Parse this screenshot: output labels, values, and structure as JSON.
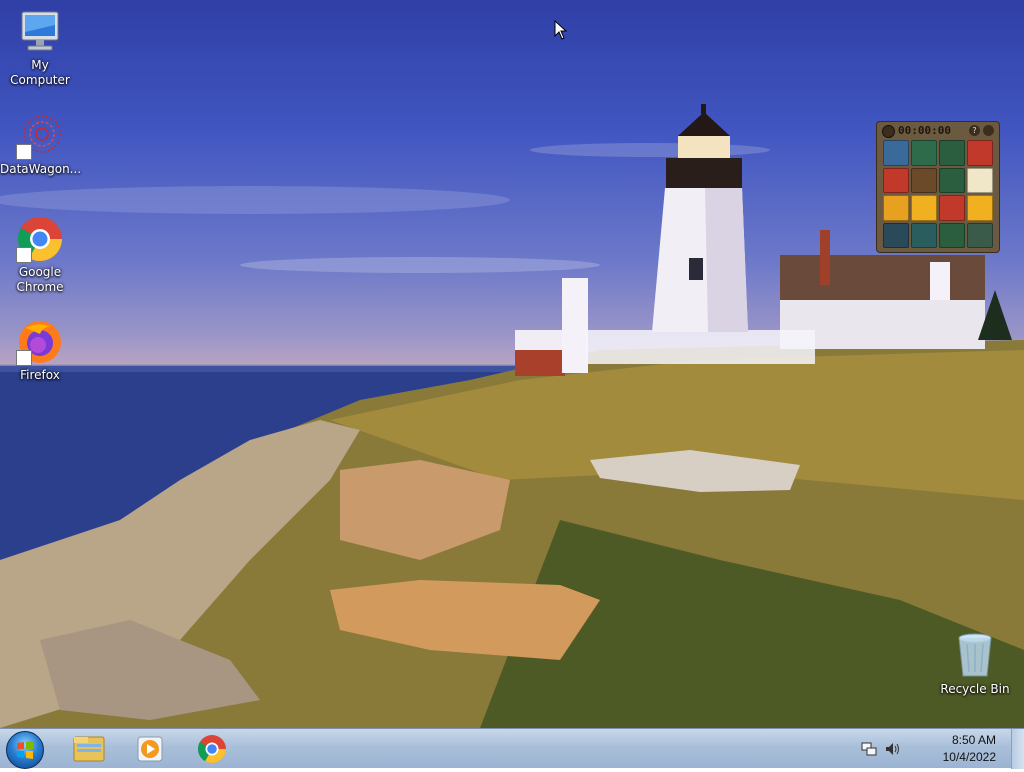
{
  "desktop": {
    "icons": [
      {
        "label": "My Computer",
        "icon": "my-computer-icon"
      },
      {
        "label": "DataWagon...",
        "icon": "datawagon-icon"
      },
      {
        "label": "Google Chrome",
        "label_line1": "Google",
        "label_line2": "Chrome",
        "icon": "chrome-icon"
      },
      {
        "label": "Firefox",
        "icon": "firefox-icon"
      },
      {
        "label": "Recycle Bin",
        "icon": "recycle-bin-icon"
      }
    ]
  },
  "gadget": {
    "name": "puzzle-gadget",
    "timer": "00:00:00",
    "tile_colors": [
      "#3a6a9a",
      "#2d6b4a",
      "#2a5e3f",
      "#c0392b",
      "#c0392b",
      "#6b4a2a",
      "#2a5e3f",
      "#f0e6c8",
      "#e8a020",
      "#f0b020",
      "#c0392b",
      "#f0b020",
      "#2a4a5a",
      "#2a5e5e",
      "#2a5e3f",
      "#3a5a4a"
    ]
  },
  "taskbar": {
    "start_button": "start-orb",
    "pinned": [
      "file-explorer-icon",
      "media-player-icon",
      "chrome-icon"
    ],
    "tray_icons": [
      "network-icon",
      "volume-icon"
    ],
    "clock_time": "8:50 AM",
    "clock_date": "10/4/2022"
  },
  "colors": {
    "taskbar_top": "#c9d8ea",
    "taskbar_bottom": "#9cb4d3",
    "gadget_frame": "#6b5a40"
  }
}
